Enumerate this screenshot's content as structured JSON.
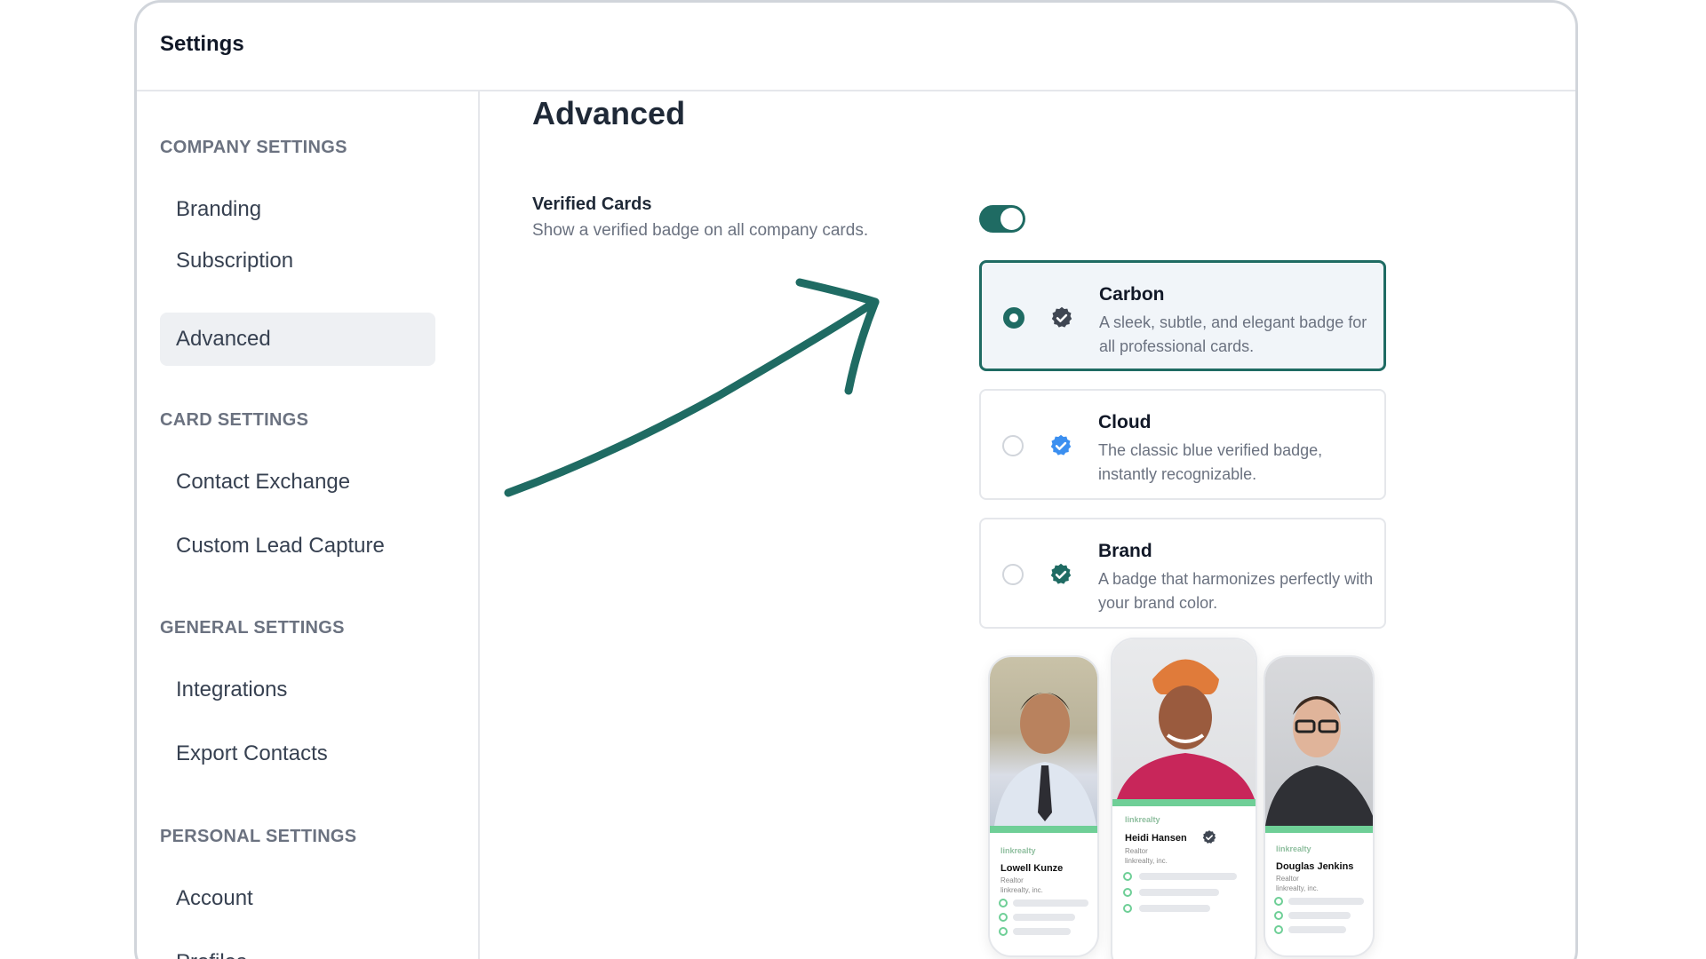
{
  "window": {
    "title": "Settings"
  },
  "sidebar": {
    "sections": [
      {
        "heading": "COMPANY SETTINGS",
        "items": [
          "Branding",
          "Subscription",
          "Advanced"
        ]
      },
      {
        "heading": "CARD SETTINGS",
        "items": [
          "Contact Exchange",
          "Custom Lead Capture"
        ]
      },
      {
        "heading": "GENERAL SETTINGS",
        "items": [
          "Integrations",
          "Export Contacts"
        ]
      },
      {
        "heading": "PERSONAL SETTINGS",
        "items": [
          "Account",
          "Profiles"
        ]
      }
    ],
    "active_item": "Advanced"
  },
  "main": {
    "title": "Advanced",
    "verified_cards": {
      "label": "Verified Cards",
      "description": "Show a verified badge on all company cards.",
      "enabled": true
    },
    "badge_options": [
      {
        "title": "Carbon",
        "description": "A sleek, subtle, and elegant badge for all professional cards.",
        "selected": true,
        "badge_color": "#3f4652",
        "icon": "verified-badge-icon"
      },
      {
        "title": "Cloud",
        "description": "The classic blue verified badge, instantly recognizable.",
        "selected": false,
        "badge_color": "#3b8ff0",
        "icon": "verified-badge-icon"
      },
      {
        "title": "Brand",
        "description": "A badge that harmonizes perfectly with your brand color.",
        "selected": false,
        "badge_color": "#1f6b63",
        "icon": "verified-badge-icon"
      }
    ],
    "preview_cards": [
      {
        "brand": "linkrealty",
        "name": "Lowell Kunze",
        "role": "Realtor",
        "company": "linkrealty, inc."
      },
      {
        "brand": "linkrealty",
        "name": "Heidi Hansen",
        "role": "Realtor",
        "company": "linkrealty, inc."
      },
      {
        "brand": "linkrealty",
        "name": "Douglas Jenkins",
        "role": "Realtor",
        "company": "linkrealty, inc."
      }
    ]
  },
  "colors": {
    "accent": "#1f6b63",
    "sidebar_active": "#eef0f3",
    "muted_text": "#6b7280"
  }
}
